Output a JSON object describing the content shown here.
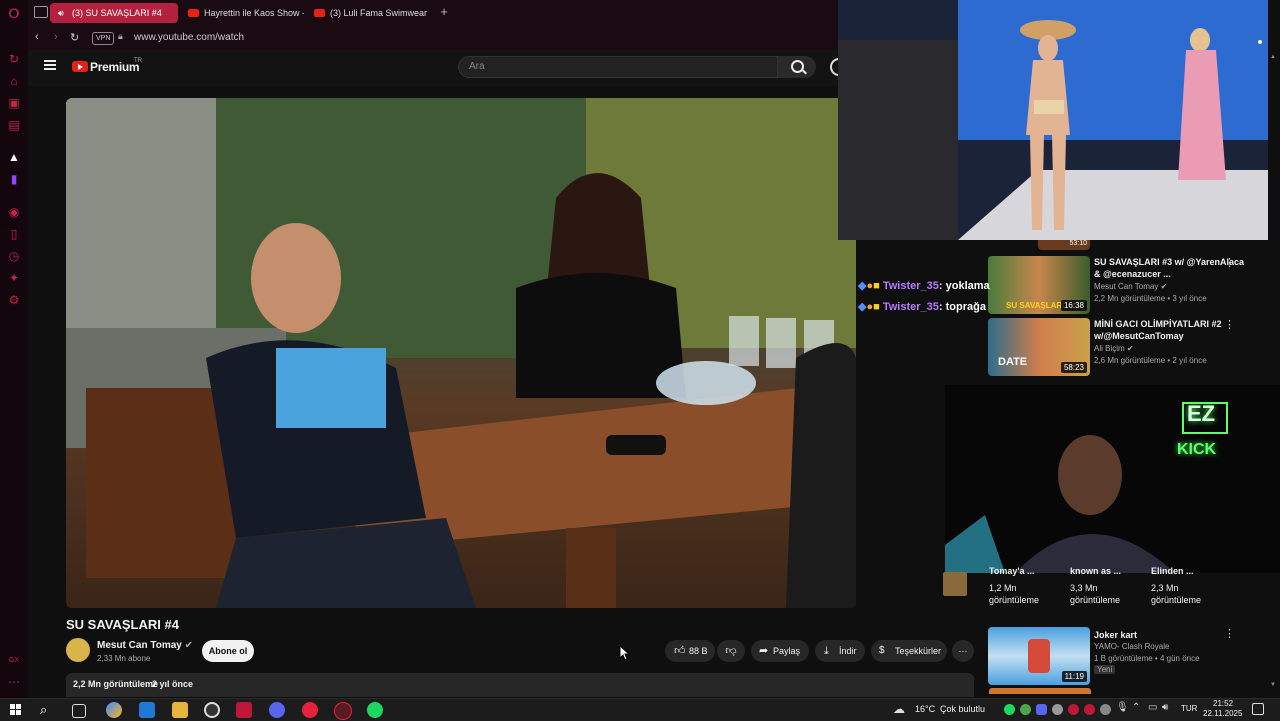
{
  "browser": {
    "tabs": [
      {
        "label": "(3) SU SAVAŞLARI #4"
      },
      {
        "label": "Hayrettin ile Kaos Show -"
      },
      {
        "label": "(3) Luli Fama Swimwear F"
      }
    ],
    "vpn_label": "VPN",
    "url": "www.youtube.com/watch"
  },
  "youtube": {
    "logo_text": "Premium",
    "logo_sup": "TR",
    "search_placeholder": "Ara"
  },
  "video": {
    "title": "SU SAVAŞLARI #4",
    "channel": "Mesut Can Tomay",
    "subscribers": "2,33 Mn abone",
    "subscribe_label": "Abone ol",
    "likes": "88 B",
    "share_label": "Paylaş",
    "download_label": "İndir",
    "thanks_label": "Teşekkürler",
    "views": "2,2 Mn görüntüleme",
    "age": "2 yıl önce"
  },
  "chat": [
    {
      "user": "Twister_35",
      "message": ": yoklama"
    },
    {
      "user": "Twister_35",
      "message": ": toprağa"
    }
  ],
  "recommendations": [
    {
      "title": "SU SAVAŞLARI #3 w/ @YarenAlaca & @ecenazucer ...",
      "channel": "Mesut Can Tomay",
      "meta": "2,2 Mn görüntüleme • 3 yıl önce",
      "duration": "16:38"
    },
    {
      "title": "MİNİ GACI OLİMPİYATLARI #2 w/@MesutCanTomay",
      "channel": "Ali Biçim",
      "meta": "2,6 Mn görüntüleme • 2 yıl önce",
      "duration": "58:23"
    },
    {
      "title": "Joker kart",
      "channel": "YAMO- Clash Royale",
      "meta": "1 B görüntüleme • 4 gün önce",
      "badge": "Yeni",
      "duration": "11:19"
    }
  ],
  "top_duration": "53:10",
  "shorts_views": [
    {
      "title": "Tomay'a ...",
      "views": "1,2 Mn",
      "unit": "görüntüleme"
    },
    {
      "title": "known as ...",
      "views": "3,3 Mn",
      "unit": "görüntüleme"
    },
    {
      "title": "Elinden ...",
      "views": "2,3 Mn",
      "unit": "görüntüleme"
    }
  ],
  "thumb_texts": {
    "rec1_overlay": "SU SAVAŞLARI",
    "rec2_overlay": "DATE"
  },
  "stream_overlay": {
    "line1": "EZ",
    "line2": "KICK"
  },
  "taskbar": {
    "weather_temp": "16°C",
    "weather_desc": "Çok bulutlu",
    "language": "TUR",
    "time": "21:52",
    "date": "22.11.2025"
  },
  "colors": {
    "accent": "#b4213f",
    "youtube_red": "#e62117",
    "chat_user": "#b57bff"
  }
}
